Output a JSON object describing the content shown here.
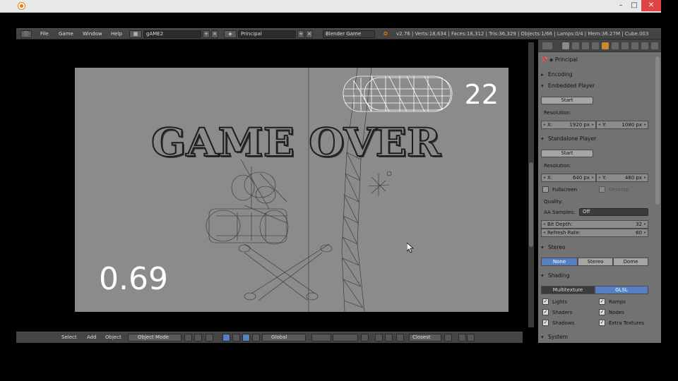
{
  "menubar": {
    "file": "File",
    "game": "Game",
    "window": "Window",
    "help": "Help",
    "screen_name": "gAME2",
    "scene_name": "Principal",
    "engine": "Blender Game",
    "stats": "v2.76 | Verts:18,634 | Faces:18,312 | Tris:36,329 | Objects:1/66 | Lamps:0/4 | Mem:36.27M | Cube.003"
  },
  "game": {
    "score": "22",
    "timer": "0.69",
    "overlay_text": "GAME OVER"
  },
  "bottombar": {
    "select": "Select",
    "add": "Add",
    "object": "Object",
    "mode": "Object Mode",
    "orientation": "Global",
    "snap": "Closest"
  },
  "props": {
    "context": "Principal",
    "encoding": "Encoding",
    "embedded_player": "Embedded Player",
    "start1": "Start",
    "resolution1": "Resolution:",
    "emb_x_label": "X:",
    "emb_x": "1920 px",
    "emb_y_label": "Y:",
    "emb_y": "1080 px",
    "standalone_player": "Standalone Player",
    "start2": "Start",
    "resolution2": "Resolution:",
    "sa_x_label": "X:",
    "sa_x": "640 px",
    "sa_y_label": "Y:",
    "sa_y": "480 px",
    "fullscreen": "Fullscreen",
    "desktop": "Desktop",
    "quality": "Quality:",
    "aa_samples": "AA Samples:",
    "aa_value": "Off",
    "bit_depth_label": "Bit Depth:",
    "bit_depth": "32",
    "refresh_label": "Refresh Rate:",
    "refresh": "60",
    "stereo": "Stereo",
    "stereo_none": "None",
    "stereo_stereo": "Stereo",
    "stereo_dome": "Dome",
    "shading": "Shading",
    "shading_multi": "Multitexture",
    "shading_glsl": "GLSL",
    "lights": "Lights",
    "ramps": "Ramps",
    "shaders": "Shaders",
    "nodes": "Nodes",
    "shadows": "Shadows",
    "extra_textures": "Extra Textures",
    "system": "System"
  },
  "colors": {
    "accent": "#5680c2",
    "close_button": "#e04343",
    "game_background": "#8b8b8b"
  }
}
